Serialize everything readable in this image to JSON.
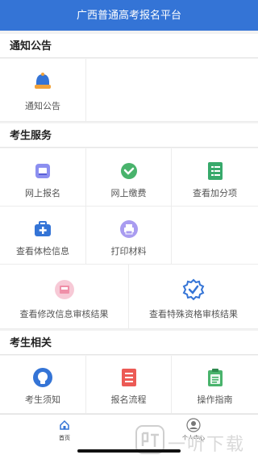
{
  "header": {
    "title": "广西普通高考报名平台"
  },
  "sections": {
    "notice": {
      "title": "通知公告",
      "items": [
        {
          "label": "通知公告",
          "icon": "bell-icon"
        }
      ]
    },
    "services": {
      "title": "考生服务",
      "items": [
        {
          "label": "网上报名",
          "icon": "register-book-icon"
        },
        {
          "label": "网上缴费",
          "icon": "payment-check-icon"
        },
        {
          "label": "查看加分项",
          "icon": "bonus-list-icon"
        },
        {
          "label": "查看体检信息",
          "icon": "medical-kit-icon"
        },
        {
          "label": "打印材料",
          "icon": "printer-icon"
        },
        {
          "label": "查看修改信息审核结果",
          "icon": "inbox-review-icon"
        },
        {
          "label": "查看特殊资格审核结果",
          "icon": "verified-badge-icon"
        }
      ]
    },
    "related": {
      "title": "考生相关",
      "items": [
        {
          "label": "考生须知",
          "icon": "notice-bulb-icon"
        },
        {
          "label": "报名流程",
          "icon": "process-document-icon"
        },
        {
          "label": "操作指南",
          "icon": "guide-clipboard-icon"
        }
      ]
    }
  },
  "tabbar": {
    "tabs": [
      {
        "label": "首页",
        "icon": "home-icon",
        "active": true
      },
      {
        "label": "个人中心",
        "icon": "user-profile-icon",
        "active": false
      }
    ]
  },
  "watermark": {
    "text": "一听下载",
    "icon": "ting-logo-icon"
  },
  "colors": {
    "brand": "#3474d6",
    "orange": "#f1a23a",
    "green": "#49b36c",
    "purple": "#7b6fe0",
    "pink": "#f3b6c9",
    "red": "#ec5a55"
  }
}
